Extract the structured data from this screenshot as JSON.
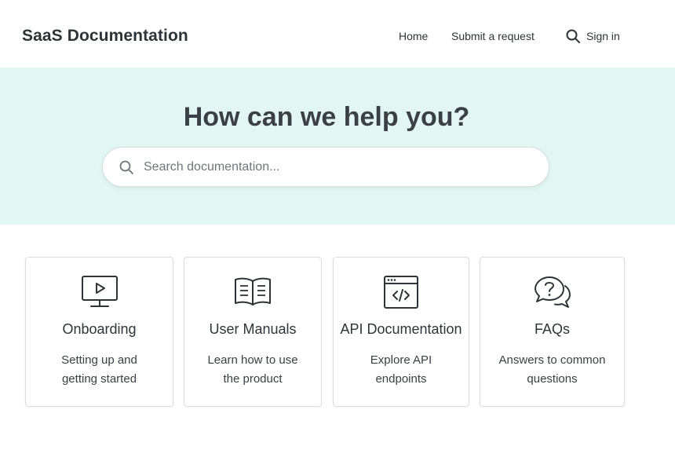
{
  "header": {
    "brand": "SaaS Documentation",
    "nav": {
      "home": "Home",
      "submit_request": "Submit a request",
      "sign_in": "Sign in"
    }
  },
  "hero": {
    "title": "How can we help you?",
    "search_placeholder": "Search documentation..."
  },
  "cards": [
    {
      "icon": "video-monitor-icon",
      "title": "Onboarding",
      "desc_line1": "Setting up and",
      "desc_line2": "getting started"
    },
    {
      "icon": "book-icon",
      "title": "User Manuals",
      "desc_line1": "Learn how to use",
      "desc_line2": "the product"
    },
    {
      "icon": "code-window-icon",
      "title": "API Documentation",
      "desc_line1": "Explore API",
      "desc_line2": "endpoints"
    },
    {
      "icon": "question-chat-icon",
      "title": "FAQs",
      "desc_line1": "Answers to common",
      "desc_line2": "questions"
    }
  ],
  "colors": {
    "hero_background": "#e2f6f4",
    "text_dark": "#2f3438",
    "card_border": "#dcdfe2"
  }
}
